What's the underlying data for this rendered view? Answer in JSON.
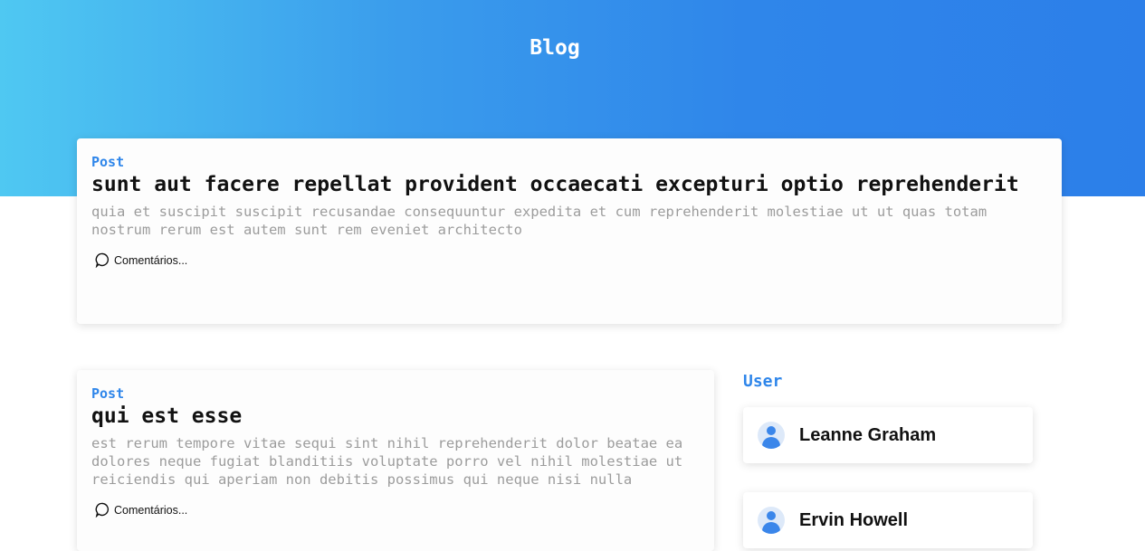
{
  "header": {
    "title": "Blog"
  },
  "posts": [
    {
      "label": "Post",
      "title": "sunt aut facere repellat provident occaecati excepturi optio reprehenderit",
      "body": "quia et suscipit suscipit recusandae consequuntur expedita et cum reprehenderit molestiae ut ut quas totam nostrum rerum est autem sunt rem eveniet architecto",
      "comments_label": "Comentários..."
    },
    {
      "label": "Post",
      "title": "qui est esse",
      "body": "est rerum tempore vitae sequi sint nihil reprehenderit dolor beatae ea dolores neque fugiat blanditiis voluptate porro vel nihil molestiae ut reiciendis qui aperiam non debitis possimus qui neque nisi nulla",
      "comments_label": "Comentários..."
    }
  ],
  "users_panel": {
    "heading": "User",
    "users": [
      {
        "name": "Leanne Graham",
        "icon": "user-avatar-icon"
      },
      {
        "name": "Ervin Howell",
        "icon": "user-avatar-icon"
      }
    ]
  },
  "colors": {
    "accent": "#2f86ea",
    "header_gradient_start": "#4fc8f2",
    "header_gradient_end": "#2c7fe9",
    "body_text": "#9c9c9c"
  },
  "icons": {
    "comment": "speech-bubble-icon"
  }
}
